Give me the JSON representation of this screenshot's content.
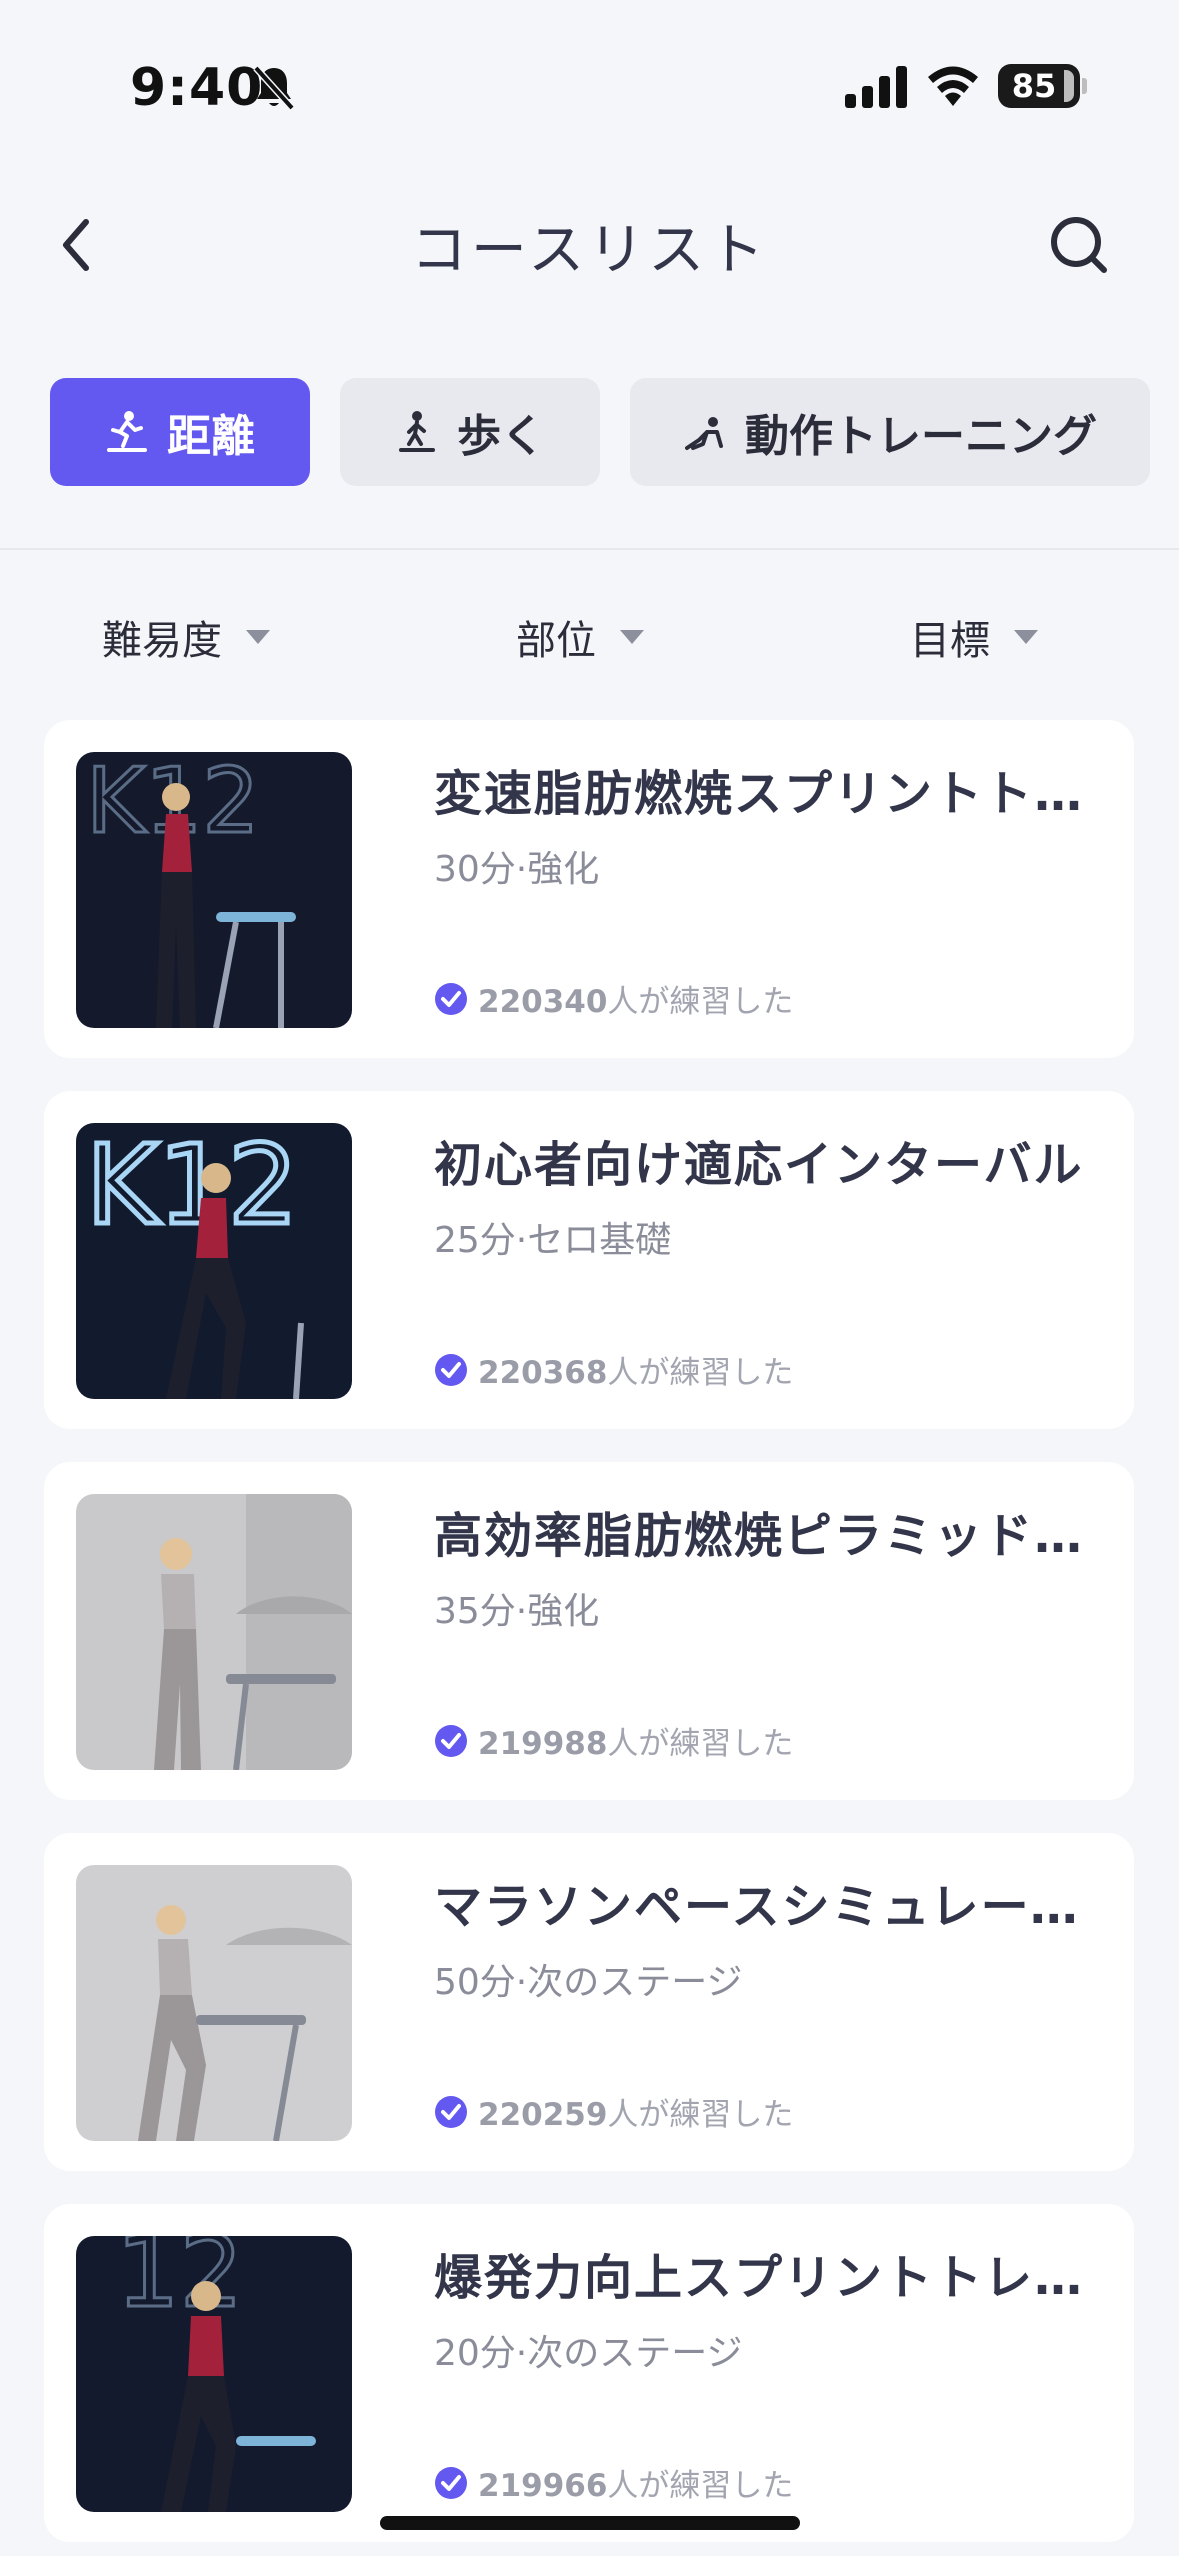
{
  "status_bar": {
    "time": "9:40",
    "battery": "85"
  },
  "nav": {
    "title": "コースリスト"
  },
  "tabs": [
    {
      "label": "距離",
      "icon": "treadmill-run-icon",
      "active": true
    },
    {
      "label": "歩く",
      "icon": "treadmill-walk-icon",
      "active": false
    },
    {
      "label": "動作トレーニング",
      "icon": "training-icon",
      "active": false
    }
  ],
  "filters": [
    {
      "label": "難易度"
    },
    {
      "label": "部位"
    },
    {
      "label": "目標"
    }
  ],
  "courses": [
    {
      "title": "変速脂肪燃焼スプリントトレーニング",
      "meta": "30分·強化",
      "count": "220340",
      "suffix": "人が練習した",
      "thumb": "dark"
    },
    {
      "title": "初心者向け適応インターバル",
      "meta": "25分·セロ基礎",
      "count": "220368",
      "suffix": "人が練習した",
      "thumb": "dark"
    },
    {
      "title": "高効率脂肪燃焼ピラミッドトレーニング",
      "meta": "35分·強化",
      "count": "219988",
      "suffix": "人が練習した",
      "thumb": "light"
    },
    {
      "title": "マラソンペースシミュレーション",
      "meta": "50分·次のステージ",
      "count": "220259",
      "suffix": "人が練習した",
      "thumb": "light"
    },
    {
      "title": "爆発力向上スプリントトレーニング",
      "meta": "20分·次のステージ",
      "count": "219966",
      "suffix": "人が練習した",
      "thumb": "dark"
    }
  ],
  "colors": {
    "accent": "#6358f0",
    "background": "#f5f6f9"
  }
}
